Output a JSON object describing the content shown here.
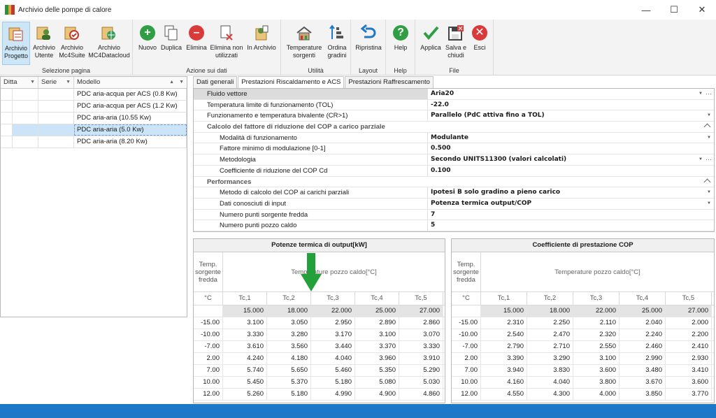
{
  "window": {
    "title": "Archivio delle pompe di calore",
    "minimize": "—",
    "maximize": "☐",
    "close": "✕"
  },
  "ribbon": {
    "groups": [
      {
        "label": "Selezione pagina",
        "buttons": [
          {
            "label": "Archivio Progetto"
          },
          {
            "label": "Archivio Utente"
          },
          {
            "label": "Archivio Mc4Suite"
          },
          {
            "label": "Archivio MC4Datacloud"
          }
        ]
      },
      {
        "label": "Azione sui dati",
        "buttons": [
          {
            "label": "Nuovo"
          },
          {
            "label": "Duplica"
          },
          {
            "label": "Elimina"
          },
          {
            "label": "Elimina non utilizzati"
          },
          {
            "label": "In Archivio"
          }
        ]
      },
      {
        "label": "Utilità",
        "buttons": [
          {
            "label": "Temperature sorgenti"
          },
          {
            "label": "Ordina gradini"
          }
        ]
      },
      {
        "label": "Layout",
        "buttons": [
          {
            "label": "Ripristina"
          }
        ]
      },
      {
        "label": "Help",
        "buttons": [
          {
            "label": "Help"
          }
        ]
      },
      {
        "label": "File",
        "buttons": [
          {
            "label": "Applica"
          },
          {
            "label": "Salva e chiudi"
          },
          {
            "label": "Esci"
          }
        ]
      }
    ]
  },
  "left_grid": {
    "columns": [
      "Ditta",
      "Serie",
      "Modello"
    ],
    "rows": [
      "PDC aria-acqua per ACS (0.8 Kw)",
      "PDC aria-acqua per ACS (1.2 Kw)",
      "PDC aria-aria (10.55 Kw)",
      "PDC aria-aria (5.0 Kw)",
      "PDC aria-aria (8.20 Kw)"
    ]
  },
  "tabs": [
    "Dati generali",
    "Prestazioni Riscaldamento e ACS",
    "Prestazioni Raffrescamento"
  ],
  "properties": {
    "fluido_label": "Fluido vettore",
    "fluido_value": "Aria20",
    "tol_label": "Temperatura limite di funzionamento (TOL)",
    "tol_value": "-22.0",
    "biv_label": "Funzionamento e temperatura bivalente (CR>1)",
    "biv_value": "Parallelo (PdC attiva fino a TOL)",
    "cat1": "Calcolo del fattore di riduzione del COP a carico parziale",
    "mod_label": "Modalità di funzionamento",
    "mod_value": "Modulante",
    "fmin_label": "Fattore minimo di modulazione [0-1]",
    "fmin_value": "0.500",
    "met_label": "Metodologia",
    "met_value": "Secondo UNITS11300 (valori calcolati)",
    "cd_label": "Coefficiente di riduzione  del COP Cd",
    "cd_value": "0.100",
    "cat2": "Performances",
    "metc_label": "Metodo di calcolo del COP ai carichi parziali",
    "metc_value": "Ipotesi B solo gradino a pieno carico",
    "dati_label": "Dati conosciuti di input",
    "dati_value": "Potenza termica output/COP",
    "nsf_label": "Numero punti sorgente fredda",
    "nsf_value": "7",
    "npc_label": "Numero punti pozzo caldo",
    "npc_value": "5"
  },
  "table_left": {
    "title": "Potenze termica di output[kW]",
    "temp_fredda": "Temp. sorgente fredda",
    "temp_caldo": "Temperature pozzo caldo[°C]",
    "unit": "°C",
    "cols": [
      "Tc,1",
      "Tc,2",
      "Tc,3",
      "Tc,4",
      "Tc,5"
    ],
    "header_vals": [
      "15.000",
      "18.000",
      "22.000",
      "25.000",
      "27.000"
    ],
    "rows": [
      [
        "-15.00",
        "3.100",
        "3.050",
        "2.950",
        "2.890",
        "2.860"
      ],
      [
        "-10.00",
        "3.330",
        "3.280",
        "3.170",
        "3.100",
        "3.070"
      ],
      [
        "-7.00",
        "3.610",
        "3.560",
        "3.440",
        "3.370",
        "3.330"
      ],
      [
        "2.00",
        "4.240",
        "4.180",
        "4.040",
        "3.960",
        "3.910"
      ],
      [
        "7.00",
        "5.740",
        "5.650",
        "5.460",
        "5.350",
        "5.290"
      ],
      [
        "10.00",
        "5.450",
        "5.370",
        "5.180",
        "5.080",
        "5.030"
      ],
      [
        "12.00",
        "5.260",
        "5.180",
        "4.990",
        "4.900",
        "4.860"
      ]
    ]
  },
  "table_right": {
    "title": "Coefficiente di prestazione COP",
    "temp_fredda": "Temp. sorgente fredda",
    "temp_caldo": "Temperature pozzo caldo[°C]",
    "unit": "°C",
    "cols": [
      "Tc,1",
      "Tc,2",
      "Tc,3",
      "Tc,4",
      "Tc,5"
    ],
    "header_vals": [
      "15.000",
      "18.000",
      "22.000",
      "25.000",
      "27.000"
    ],
    "rows": [
      [
        "-15.00",
        "2.310",
        "2.250",
        "2.110",
        "2.040",
        "2.000"
      ],
      [
        "-10.00",
        "2.540",
        "2.470",
        "2.320",
        "2.240",
        "2.200"
      ],
      [
        "-7.00",
        "2.790",
        "2.710",
        "2.550",
        "2.460",
        "2.410"
      ],
      [
        "2.00",
        "3.390",
        "3.290",
        "3.100",
        "2.990",
        "2.930"
      ],
      [
        "7.00",
        "3.940",
        "3.830",
        "3.600",
        "3.480",
        "3.410"
      ],
      [
        "10.00",
        "4.160",
        "4.040",
        "3.800",
        "3.670",
        "3.600"
      ],
      [
        "12.00",
        "4.550",
        "4.300",
        "4.000",
        "3.850",
        "3.770"
      ]
    ]
  },
  "colors": {
    "accent": "#1e78c8",
    "selection": "#cce4f7",
    "arrow": "#22a03a"
  }
}
